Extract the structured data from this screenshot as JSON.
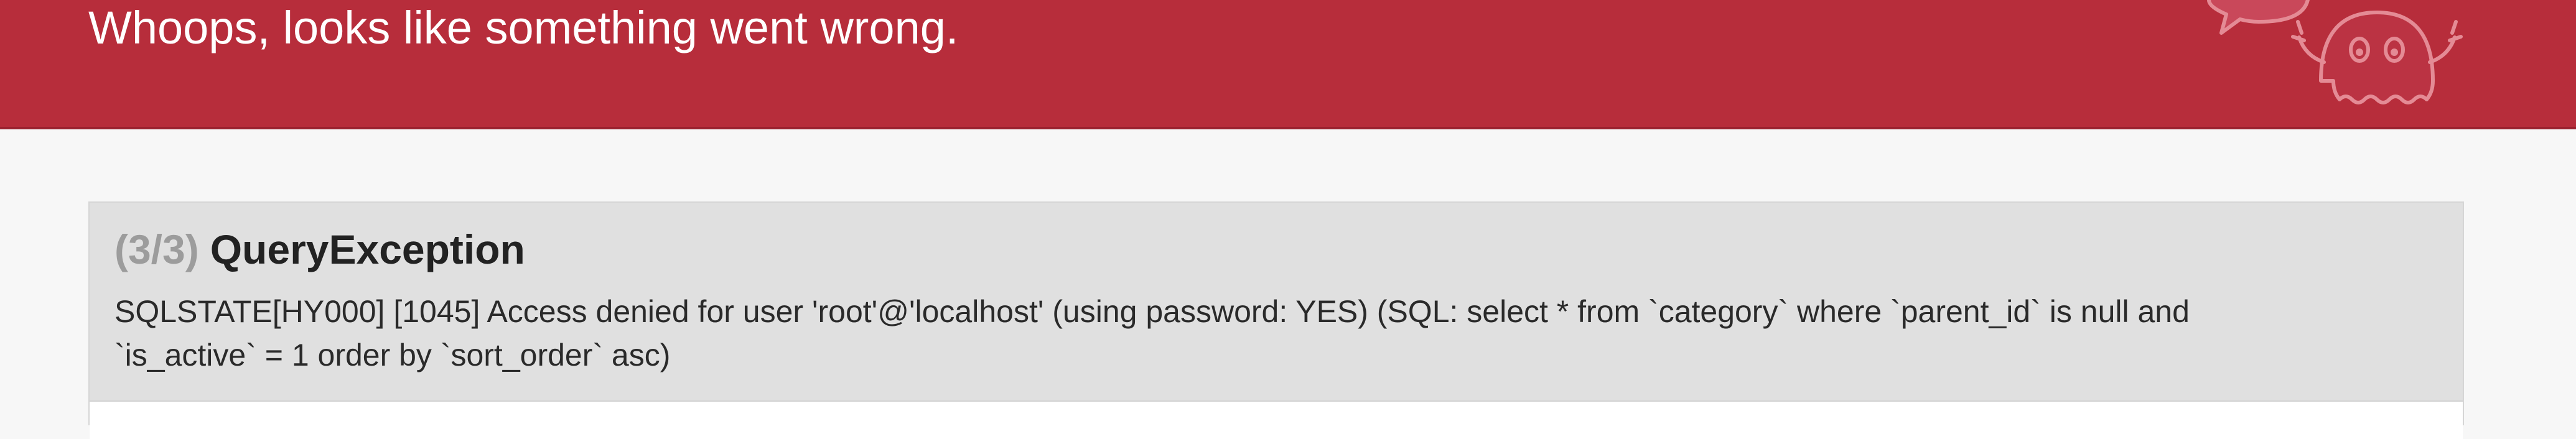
{
  "header": {
    "title": "Whoops, looks like something went wrong.",
    "mascot_icon": "ghost-mascot-icon",
    "background_color": "#b72d3b"
  },
  "exception": {
    "counter": "(3/3)",
    "type": "QueryException",
    "message_line_1": "SQLSTATE[HY000] [1045] Access denied for user 'root'@'localhost' (using password: YES) (SQL: select * from `category` where `parent_id` is null and",
    "message_line_2": "`is_active` = 1 order by `sort_order` asc)"
  }
}
